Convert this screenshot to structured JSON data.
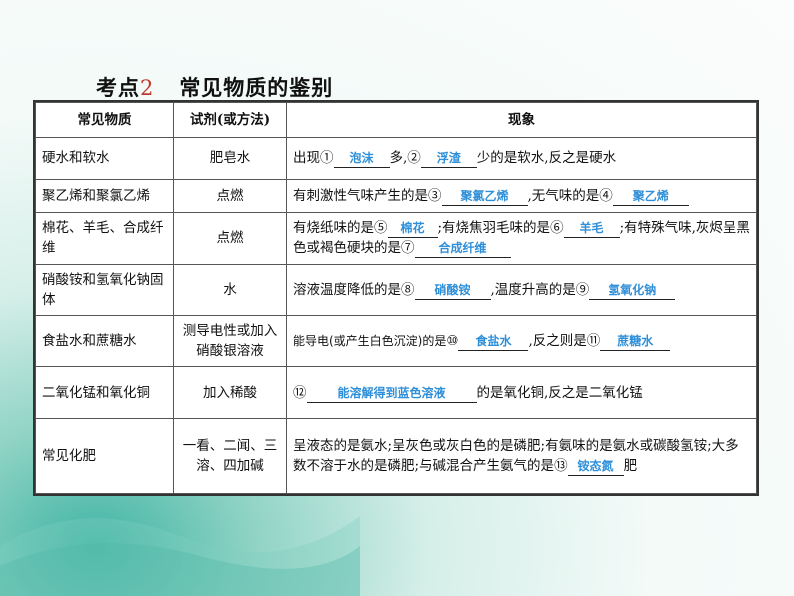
{
  "heading": {
    "prefix": "考点",
    "number": "2",
    "text": "常见物质的鉴别"
  },
  "table": {
    "headers": [
      "常见物质",
      "试剂(或方法)",
      "现象"
    ],
    "rows": [
      {
        "substance": "硬水和软水",
        "reagent": "肥皂水",
        "parts": [
          "出现",
          "①",
          "泡沫",
          "多,",
          "②",
          "浮渣",
          "少的是软水,反之是硬水"
        ]
      },
      {
        "substance": "聚乙烯和聚氯乙烯",
        "reagent": "点燃",
        "parts": [
          "有刺激性气味产生的是",
          "③",
          "聚氯乙烯",
          ",无气味的是",
          "④",
          "聚乙烯"
        ]
      },
      {
        "substance": "棉花、羊毛、合成纤维",
        "reagent": "点燃",
        "parts": [
          "有烧纸味的是",
          "⑤",
          "棉花",
          ";有烧焦羽毛味的是",
          "⑥",
          "羊毛",
          ";有特殊气味,灰烬呈黑色或褐色硬块的是",
          "⑦",
          "合成纤维"
        ]
      },
      {
        "substance": "硝酸铵和氢氧化钠固体",
        "reagent": "水",
        "parts": [
          "溶液温度降低的是",
          "⑧",
          "硝酸铵",
          ",温度升高的是",
          "⑨",
          "氢氧化钠"
        ]
      },
      {
        "substance": "食盐水和蔗糖水",
        "reagent": "测导电性或加入硝酸银溶液",
        "parts": [
          "能导电(或产生白色沉淀)的是",
          "⑩",
          "食盐水",
          ",反之则是",
          "⑪",
          "蔗糖水"
        ]
      },
      {
        "substance": "二氧化锰和氧化铜",
        "reagent": "加入稀酸",
        "parts": [
          "⑫",
          "能溶解得到蓝色溶液",
          "的是氧化铜,反之是二氧化锰"
        ]
      },
      {
        "substance": "常见化肥",
        "reagent": "一看、二闻、三溶、四加碱",
        "parts": [
          "呈液态的是氨水;呈灰色或灰白色的是磷肥;有氨味的是氨水或碳酸氢铵;大多数不溶于水的是磷肥;与碱混合产生氨气的是",
          "⑬",
          "铵态氮",
          "肥"
        ]
      }
    ]
  },
  "colors": {
    "answer": "#2f8fd8",
    "title_number": "#c0392b"
  }
}
